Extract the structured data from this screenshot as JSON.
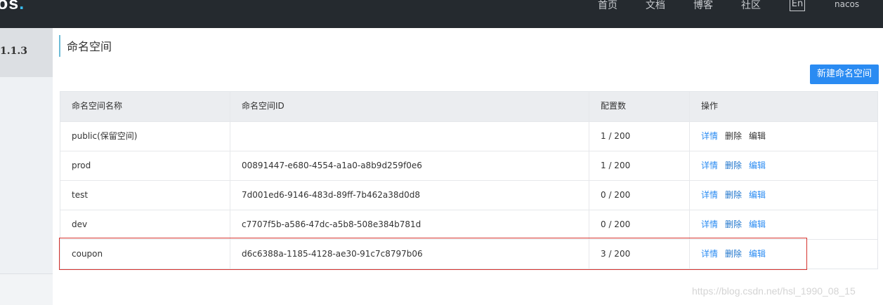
{
  "header": {
    "logo_text": "os",
    "logo_dot": ".",
    "nav": [
      "首页",
      "文档",
      "博客",
      "社区"
    ],
    "lang": "En",
    "user": "nacos"
  },
  "sidebar": {
    "version": "1.1.3"
  },
  "main": {
    "title": "命名空间",
    "new_button": "新建命名空间",
    "columns": [
      "命名空间名称",
      "命名空间ID",
      "配置数",
      "操作"
    ],
    "rows": [
      {
        "name": "public(保留空间)",
        "id": "",
        "count": "1 / 200",
        "actions": [
          "详情",
          "删除",
          "编辑"
        ]
      },
      {
        "name": "prod",
        "id": "00891447-e680-4554-a1a0-a8b9d259f0e6",
        "count": "1 / 200",
        "actions": [
          "详情",
          "删除",
          "编辑"
        ]
      },
      {
        "name": "test",
        "id": "7d001ed6-9146-483d-89ff-7b462a38d0d8",
        "count": "0 / 200",
        "actions": [
          "详情",
          "删除",
          "编辑"
        ]
      },
      {
        "name": "dev",
        "id": "c7707f5b-a586-47dc-a5b8-508e384b781d",
        "count": "0 / 200",
        "actions": [
          "详情",
          "删除",
          "编辑"
        ]
      },
      {
        "name": "coupon",
        "id": "d6c6388a-1185-4128-ae30-91c7c8797b06",
        "count": "3 / 200",
        "actions": [
          "详情",
          "删除",
          "编辑"
        ]
      }
    ]
  },
  "watermark": "https://blog.csdn.net/hsl_1990_08_15",
  "colors": {
    "topbar": "#252a2f",
    "accent": "#2a8bf2",
    "highlight": "#d6332e"
  }
}
